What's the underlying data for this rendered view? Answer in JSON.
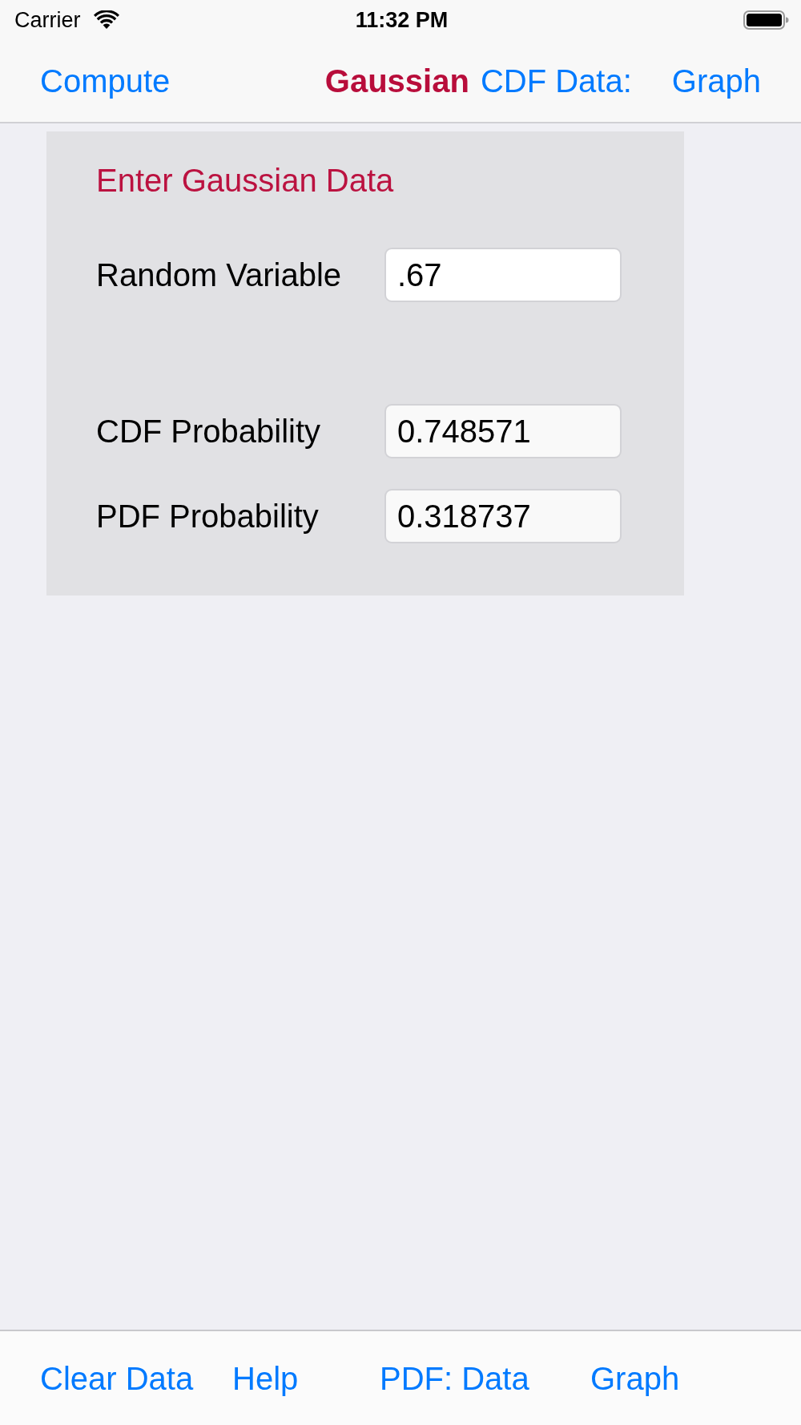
{
  "status_bar": {
    "carrier": "Carrier",
    "time": "11:32 PM"
  },
  "nav_bar": {
    "left_button": "Compute",
    "title": "Gaussian",
    "right_buttons": [
      "CDF Data:",
      "Graph"
    ]
  },
  "panel": {
    "heading": "Enter Gaussian Data",
    "inputs": [
      {
        "label": "Random Variable",
        "value": ".67"
      }
    ],
    "outputs": [
      {
        "label": "CDF Probability",
        "value": "0.748571"
      },
      {
        "label": "PDF Probability",
        "value": "0.318737"
      }
    ]
  },
  "toolbar": {
    "buttons": [
      "Clear Data",
      "Help",
      "PDF: Data",
      "Graph"
    ]
  }
}
